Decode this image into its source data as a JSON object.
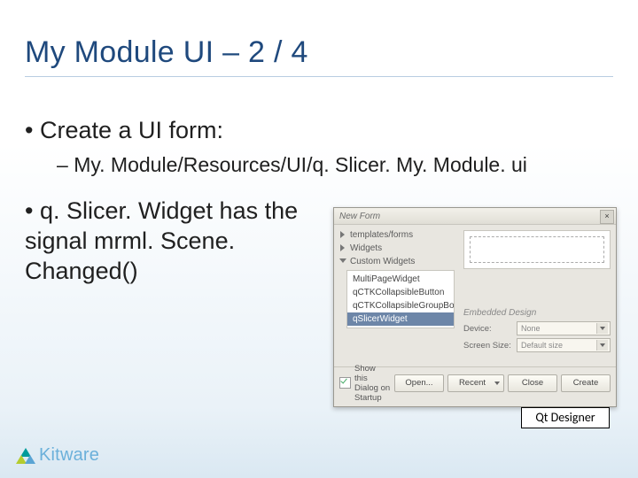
{
  "slide": {
    "title": "My Module UI – 2 / 4",
    "bullet1": "Create a UI form:",
    "sub1": "My. Module/Resources/UI/q. Slicer. My. Module. ui",
    "bullet2": "q. Slicer. Widget has the signal mrml. Scene. Changed()"
  },
  "dialog": {
    "title": "New Form",
    "close": "×",
    "tree": {
      "templates": "templates/forms",
      "widgets": "Widgets",
      "custom": "Custom Widgets",
      "items": [
        "MultiPageWidget",
        "qCTKCollapsibleButton",
        "qCTKCollapsibleGroupBox"
      ],
      "selected": "qSlicerWidget"
    },
    "embedded": "Embedded Design",
    "device_label": "Device:",
    "device_value": "None",
    "size_label": "Screen Size:",
    "size_value": "Default size",
    "startup_chk": "Show this Dialog on Startup",
    "buttons": {
      "open": "Open...",
      "recent": "Recent",
      "close": "Close",
      "create": "Create"
    }
  },
  "caption": "Qt Designer",
  "logo": "Kitware"
}
